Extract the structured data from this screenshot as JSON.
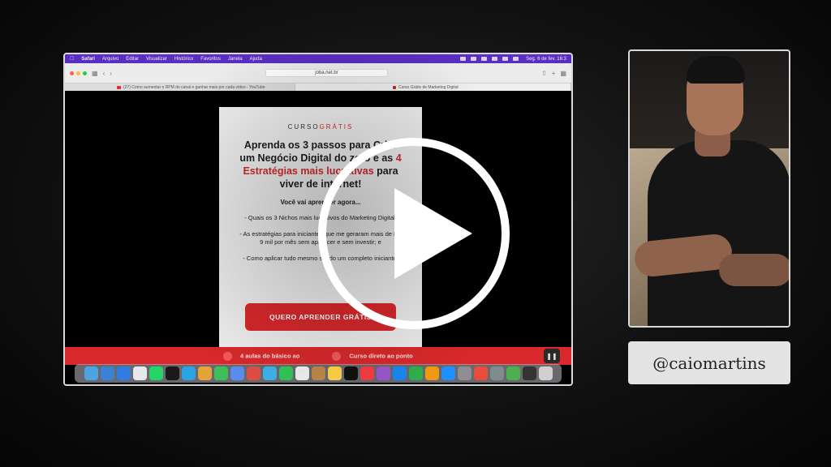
{
  "macos": {
    "menubar": {
      "items": [
        "Safari",
        "Arquivo",
        "Editar",
        "Visualizar",
        "Histórico",
        "Favoritos",
        "Janela",
        "Ajuda"
      ],
      "clock": "Seg. 6 de fev. 16:3"
    }
  },
  "browser": {
    "url": "joba.net.br",
    "tabs": [
      {
        "label": "(27) Como aumentar o RPM do canal e ganhar mais por cada vídeo - YouTube"
      },
      {
        "label": "Curso Grátis de Marketing Digital"
      }
    ]
  },
  "landing": {
    "kicker_prefix": "CURSO",
    "kicker_highlight": "GRÁTIS",
    "headline_part1": "Aprenda os 3 passos para Criar um Negócio Digital do zero e as ",
    "headline_highlight": "4 Estratégias mais lucrativas",
    "headline_part2": " para viver de internet!",
    "subheading": "Você vai aprender agora...",
    "bullets": [
      "- Quais os 3 Nichos mais lucrativos do Marketing Digital;",
      "- As estratégias para iniciantes que me geraram mais de R$ 9 mil por mês sem aparecer e sem investir; e",
      "- Como aplicar tudo mesmo sendo um completo iniciante!"
    ],
    "cta_label": "QUERO APRENDER GRÁTIS",
    "band_items": [
      "4 aulas do básico ao",
      "Curso direto ao ponto"
    ]
  },
  "player": {
    "play_icon": "play-icon",
    "pause_icon": "pause-icon"
  },
  "presenter": {
    "handle": "@caiomartins"
  },
  "colors": {
    "menubar": "#5a2ec0",
    "accent_red": "#d9292c",
    "frame": "#d9d9d9"
  }
}
